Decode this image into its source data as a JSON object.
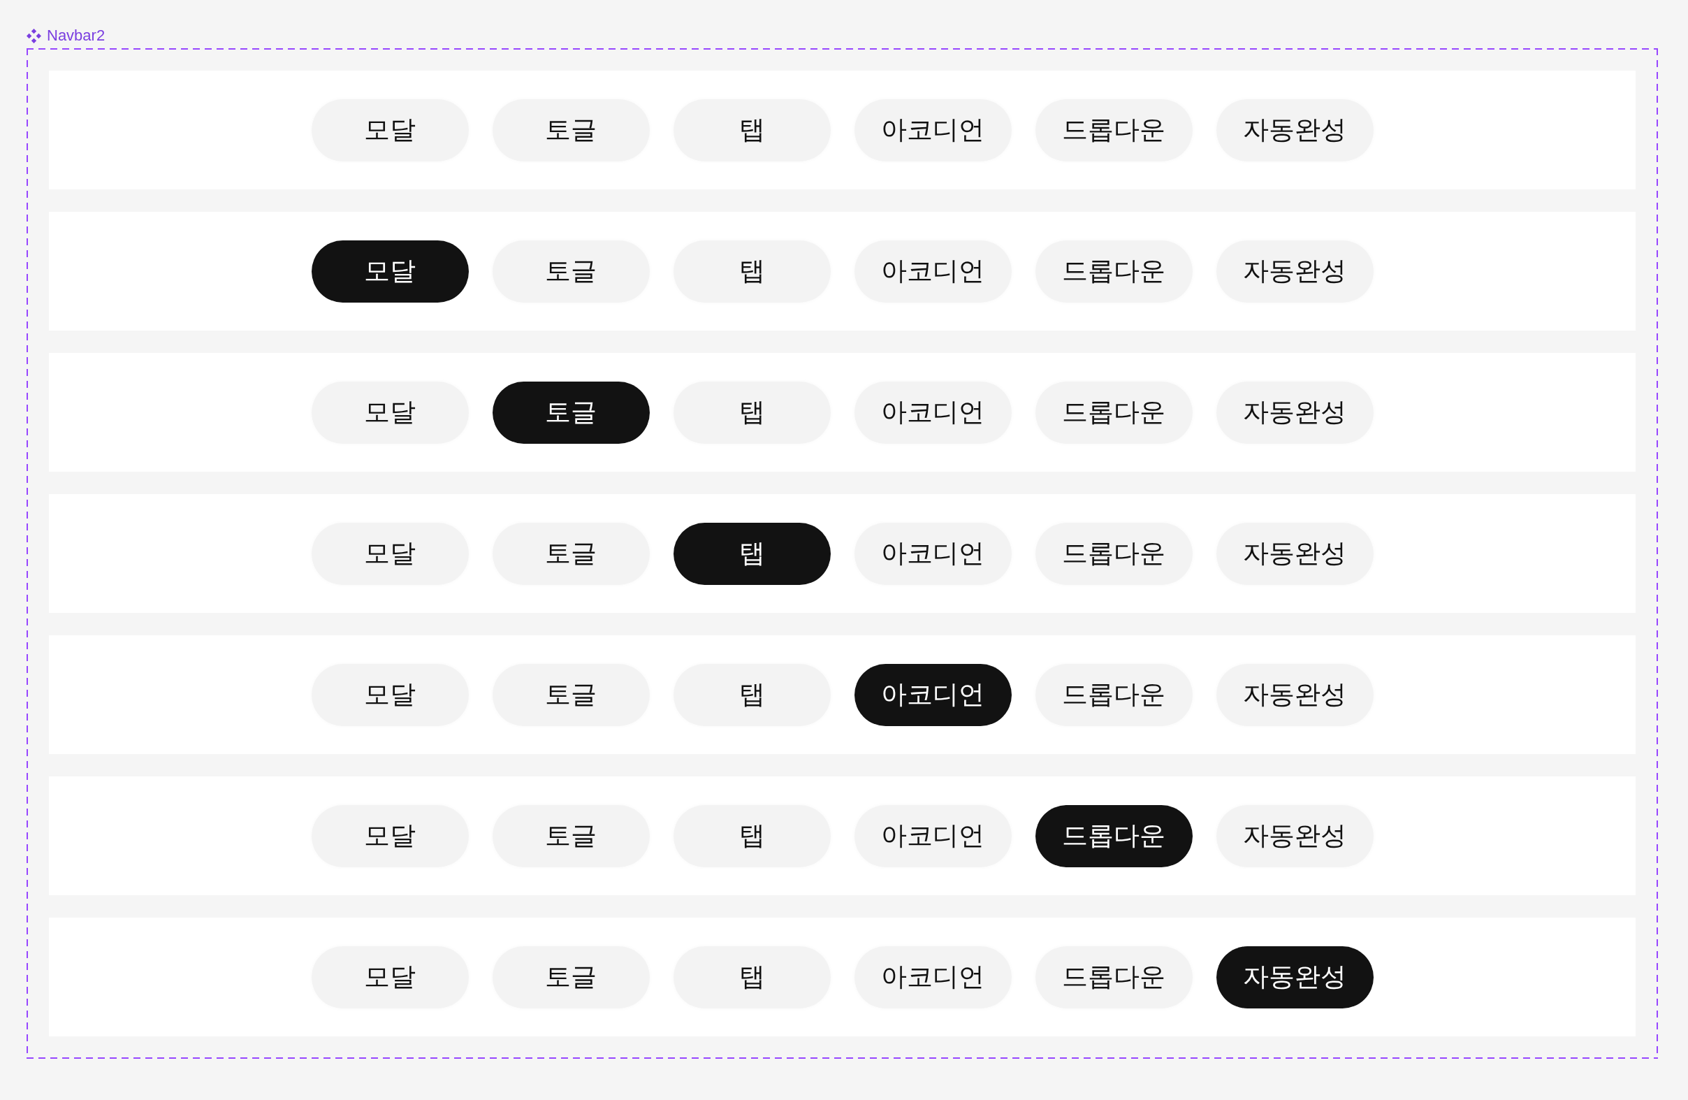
{
  "frame": {
    "label": "Navbar2"
  },
  "navbars": [
    {
      "items": [
        {
          "label": "모달",
          "selected": false
        },
        {
          "label": "토글",
          "selected": false
        },
        {
          "label": "탭",
          "selected": false
        },
        {
          "label": "아코디언",
          "selected": false
        },
        {
          "label": "드롭다운",
          "selected": false
        },
        {
          "label": "자동완성",
          "selected": false
        }
      ]
    },
    {
      "items": [
        {
          "label": "모달",
          "selected": true
        },
        {
          "label": "토글",
          "selected": false
        },
        {
          "label": "탭",
          "selected": false
        },
        {
          "label": "아코디언",
          "selected": false
        },
        {
          "label": "드롭다운",
          "selected": false
        },
        {
          "label": "자동완성",
          "selected": false
        }
      ]
    },
    {
      "items": [
        {
          "label": "모달",
          "selected": false
        },
        {
          "label": "토글",
          "selected": true
        },
        {
          "label": "탭",
          "selected": false
        },
        {
          "label": "아코디언",
          "selected": false
        },
        {
          "label": "드롭다운",
          "selected": false
        },
        {
          "label": "자동완성",
          "selected": false
        }
      ]
    },
    {
      "items": [
        {
          "label": "모달",
          "selected": false
        },
        {
          "label": "토글",
          "selected": false
        },
        {
          "label": "탭",
          "selected": true
        },
        {
          "label": "아코디언",
          "selected": false
        },
        {
          "label": "드롭다운",
          "selected": false
        },
        {
          "label": "자동완성",
          "selected": false
        }
      ]
    },
    {
      "items": [
        {
          "label": "모달",
          "selected": false
        },
        {
          "label": "토글",
          "selected": false
        },
        {
          "label": "탭",
          "selected": false
        },
        {
          "label": "아코디언",
          "selected": true
        },
        {
          "label": "드롭다운",
          "selected": false
        },
        {
          "label": "자동완성",
          "selected": false
        }
      ]
    },
    {
      "items": [
        {
          "label": "모달",
          "selected": false
        },
        {
          "label": "토글",
          "selected": false
        },
        {
          "label": "탭",
          "selected": false
        },
        {
          "label": "아코디언",
          "selected": false
        },
        {
          "label": "드롭다운",
          "selected": true
        },
        {
          "label": "자동완성",
          "selected": false
        }
      ]
    },
    {
      "items": [
        {
          "label": "모달",
          "selected": false
        },
        {
          "label": "토글",
          "selected": false
        },
        {
          "label": "탭",
          "selected": false
        },
        {
          "label": "아코디언",
          "selected": false
        },
        {
          "label": "드롭다운",
          "selected": false
        },
        {
          "label": "자동완성",
          "selected": true
        }
      ]
    }
  ]
}
